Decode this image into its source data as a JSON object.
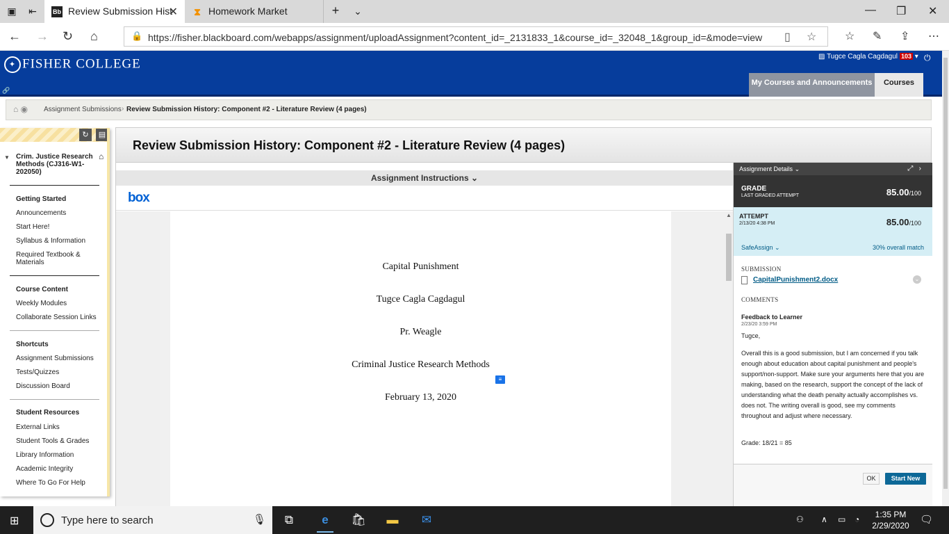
{
  "browser": {
    "tabs": [
      {
        "label": "Review Submission Hist",
        "favicon": "Bb"
      },
      {
        "label": "Homework Market",
        "favicon": "hm"
      }
    ],
    "url": "https://fisher.blackboard.com/webapps/assignment/uploadAssignment?content_id=_2131833_1&course_id=_32048_1&group_id=&mode=view"
  },
  "header": {
    "logo_text": "FISHER COLLEGE",
    "user_name": "Tugce Cagla Cagdagul",
    "notification_count": "103",
    "nav_tabs": [
      "My Courses and Announcements",
      "Courses"
    ]
  },
  "breadcrumb": {
    "items": [
      "Assignment Submissions",
      "Review Submission History: Component #2 - Literature Review (4 pages)"
    ]
  },
  "course_menu": {
    "course_title": "Crim. Justice Research Methods (CJ316-W1-202050)",
    "sections": [
      {
        "heading": "Getting Started",
        "items": [
          "Announcements",
          "Start Here!",
          "Syllabus & Information",
          "Required Textbook & Materials"
        ]
      },
      {
        "heading": "Course Content",
        "items": [
          "Weekly Modules",
          "Collaborate Session Links"
        ]
      },
      {
        "heading": "Shortcuts",
        "items": [
          "Assignment Submissions",
          "Tests/Quizzes",
          "Discussion Board"
        ]
      },
      {
        "heading": "Student Resources",
        "items": [
          "External Links",
          "Student Tools & Grades",
          "Library Information",
          "Academic Integrity",
          "Where To Go For Help"
        ]
      }
    ]
  },
  "page": {
    "title": "Review Submission History: Component #2 - Literature Review (4 pages)",
    "instructions_label": "Assignment Instructions",
    "viewer_logo": "box"
  },
  "document": {
    "lines": [
      "Capital Punishment",
      "Tugce Cagla Cagdagul",
      "Pr. Weagle",
      "Criminal Justice Research Methods",
      "February 13, 2020"
    ]
  },
  "details": {
    "header_label": "Assignment Details",
    "grade": {
      "label": "GRADE",
      "sublabel": "LAST GRADED ATTEMPT",
      "score": "85.00",
      "max": "/100"
    },
    "attempt": {
      "label": "ATTEMPT",
      "date": "2/13/20 4:38 PM",
      "score": "85.00",
      "max": "/100"
    },
    "safeassign_label": "SafeAssign",
    "match": "30% overall match",
    "submission_label": "SUBMISSION",
    "file_name": "CapitalPunishment2.docx",
    "comments_label": "COMMENTS",
    "feedback": {
      "title": "Feedback to Learner",
      "date": "2/23/20 3:59 PM",
      "greeting": "Tugce,",
      "body": "Overall this is a good submission, but I am concerned if you talk enough about education about capital punishment and people's support/non-support. Make sure your arguments here that you are making, based on the research, support the concept of the lack of understanding what the death penalty actually accomplishes vs. does not. The writing overall is good, see my comments throughout and adjust where necessary.",
      "grade_line": "Grade: 18/21 = 85"
    },
    "ok_label": "OK",
    "start_new_label": "Start New"
  },
  "taskbar": {
    "search_placeholder": "Type here to search",
    "time": "1:35 PM",
    "date": "2/29/2020"
  },
  "colors": {
    "header_blue": "#063d9c",
    "link_blue": "#005b86",
    "attempt_bg": "#d5eef5",
    "start_new_bg": "#0d6897"
  }
}
